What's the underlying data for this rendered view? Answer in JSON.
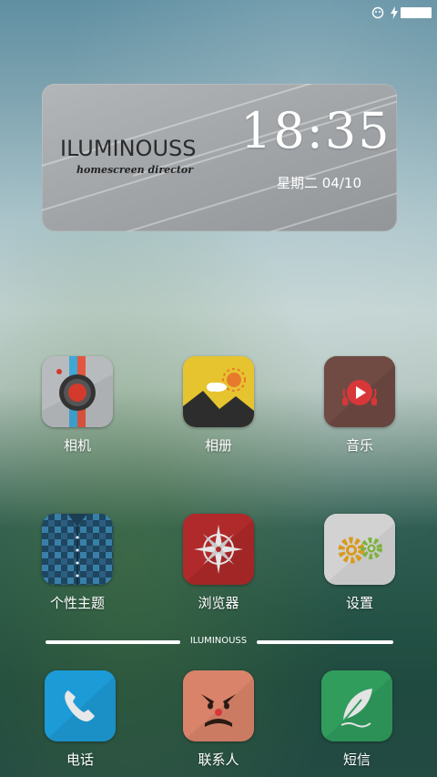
{
  "statusbar": {
    "status_icon": "face-icon",
    "charging_icon": "lightning-icon"
  },
  "widget": {
    "brand": "ILUMINOUSS",
    "tagline": "homescreen director",
    "time": "18:35",
    "date": "星期二 04/10"
  },
  "apps_row1": [
    {
      "label": "相机",
      "icon": "camera-icon"
    },
    {
      "label": "相册",
      "icon": "gallery-icon"
    },
    {
      "label": "音乐",
      "icon": "music-icon"
    }
  ],
  "apps_row2": [
    {
      "label": "个性主题",
      "icon": "theme-icon"
    },
    {
      "label": "浏览器",
      "icon": "compass-icon"
    },
    {
      "label": "设置",
      "icon": "gear-icon"
    }
  ],
  "divider_label": "ILUMINOUSS",
  "dock": [
    {
      "label": "电话",
      "icon": "phone-icon"
    },
    {
      "label": "联系人",
      "icon": "contacts-icon"
    },
    {
      "label": "短信",
      "icon": "feather-icon"
    }
  ]
}
